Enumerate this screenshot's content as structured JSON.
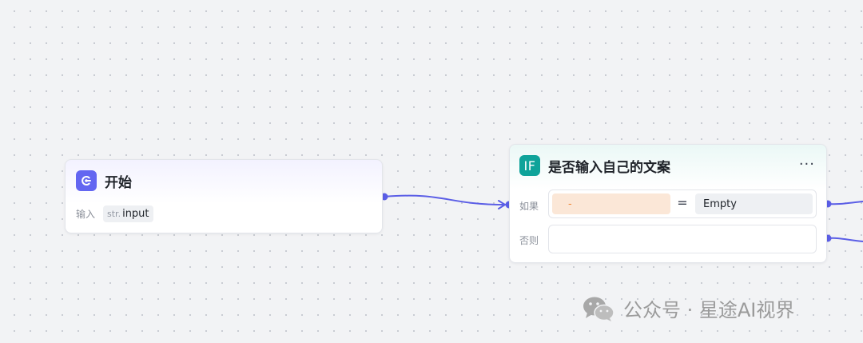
{
  "canvas": {
    "background": "#f2f3f5",
    "accent": "#5b5ee6"
  },
  "start_node": {
    "title": "开始",
    "icon": "start-play-icon",
    "icon_color": "#6366f1",
    "input_label": "输入",
    "variable_type": "str.",
    "variable_name": "input"
  },
  "if_node": {
    "icon_text": "IF",
    "icon_color": "#0fa39a",
    "title": "是否输入自己的文案",
    "more": "···",
    "if_label": "如果",
    "else_label": "否则",
    "condition": {
      "left_value": "-",
      "operator": "=",
      "right_value": "Empty"
    }
  },
  "watermark": {
    "text": "公众号 · 星途AI视界",
    "icon": "wechat-icon"
  }
}
